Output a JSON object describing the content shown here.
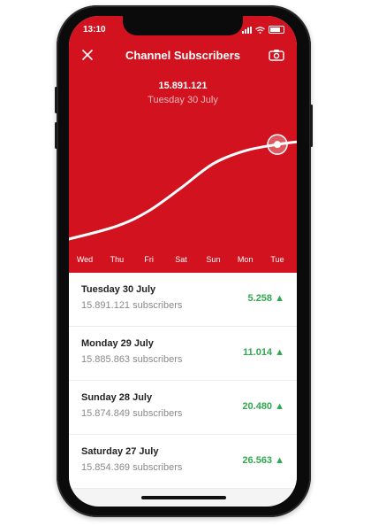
{
  "status": {
    "time": "13:10"
  },
  "header": {
    "title": "Channel Subscribers",
    "close_icon": "close-icon",
    "camera_icon": "camera-icon",
    "selected_value": "15.891.121",
    "selected_date": "Tuesday 30 July"
  },
  "chart_data": {
    "type": "line",
    "categories": [
      "Wed",
      "Thu",
      "Fri",
      "Sat",
      "Sun",
      "Mon",
      "Tue"
    ],
    "values": [
      15811000,
      15822000,
      15835000,
      15854369,
      15874849,
      15885863,
      15891121
    ],
    "ylim": [
      15805000,
      15895000
    ],
    "grid": false,
    "colors": {
      "line": "#ffffff",
      "background": "#d2121e"
    }
  },
  "list": [
    {
      "day": "Tuesday 30 July",
      "subscribers": "15.891.121 subscribers",
      "delta": "5.258 ▲"
    },
    {
      "day": "Monday 29 July",
      "subscribers": "15.885.863 subscribers",
      "delta": "11.014 ▲"
    },
    {
      "day": "Sunday 28 July",
      "subscribers": "15.874.849 subscribers",
      "delta": "20.480 ▲"
    },
    {
      "day": "Saturday 27 July",
      "subscribers": "15.854.369 subscribers",
      "delta": "26.563 ▲"
    }
  ],
  "colors": {
    "accent": "#d2121e",
    "positive": "#2fa84f"
  }
}
